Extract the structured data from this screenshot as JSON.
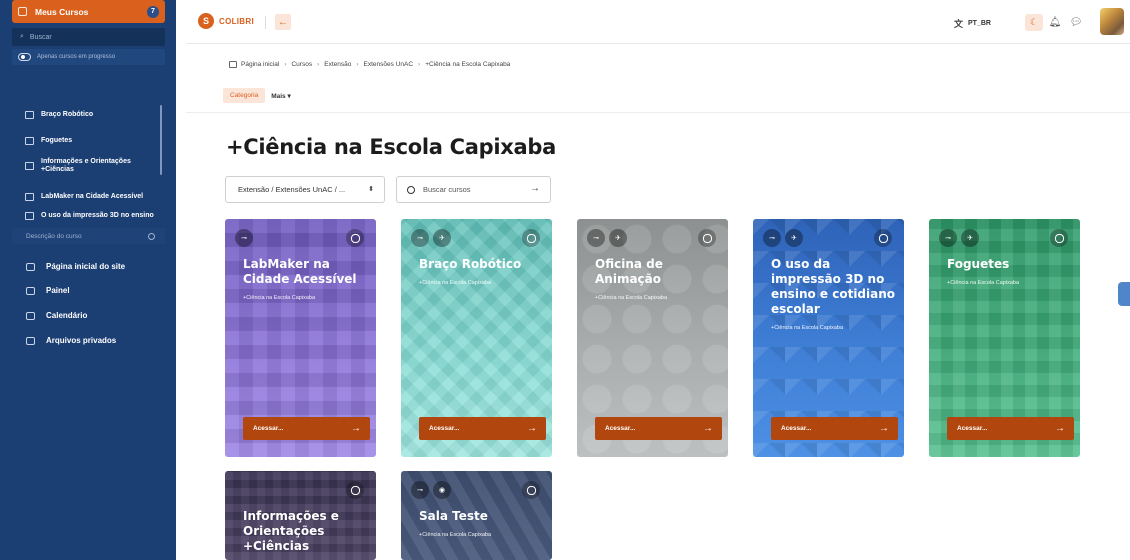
{
  "sidebar": {
    "title": "Meus Cursos",
    "badge": "7",
    "search_placeholder": "Buscar",
    "toggle_label": "Apenas cursos em progresso",
    "courses": [
      {
        "label": "Braço Robótico"
      },
      {
        "label": "Foguetes"
      },
      {
        "label": "Informações e Orientações +Ciências"
      },
      {
        "label": "LabMaker na Cidade Acessível"
      },
      {
        "label": "O uso da impressão 3D no ensino"
      }
    ],
    "description_label": "Descrição do curso",
    "nav": [
      {
        "label": "Página inicial do site"
      },
      {
        "label": "Painel"
      },
      {
        "label": "Calendário"
      },
      {
        "label": "Arquivos privados"
      }
    ]
  },
  "topbar": {
    "logo_letter": "S",
    "logo_text": "COLIBRI",
    "language": "PT_BR"
  },
  "breadcrumb": [
    "Página inicial",
    "Cursos",
    "Extensão",
    "Extensões UnAC",
    "+Ciência na Escola Capixaba"
  ],
  "category_button": "Categoria",
  "more_button": "Mais ▾",
  "page_title": "+Ciência na Escola Capixaba",
  "filter": {
    "select_value": "Extensão / Extensões UnAC / ...",
    "search_placeholder": "Buscar cursos"
  },
  "cards": [
    {
      "title": "LabMaker na Cidade Acessível",
      "subtitle": "+Ciência na Escola Capixaba",
      "button": "Acessar...",
      "color": "#8b73d6"
    },
    {
      "title": "Braço Robótico",
      "subtitle": "+Ciência na Escola Capixaba",
      "button": "Acessar...",
      "color": "#7fd8d0"
    },
    {
      "title": "Oficina de Animação",
      "subtitle": "+Ciência na Escola Capixaba",
      "button": "Acessar...",
      "color": "#a9acac"
    },
    {
      "title": "O uso da impressão 3D no ensino e cotidiano escolar",
      "subtitle": "+Ciência na Escola Capixaba",
      "button": "Acessar...",
      "color": "#3e7bd1"
    },
    {
      "title": "Foguetes",
      "subtitle": "+Ciência na Escola Capixaba",
      "button": "Acessar...",
      "color": "#3fae7b"
    },
    {
      "title": "Informações e Orientações +Ciências",
      "subtitle": "",
      "button": "Acessar...",
      "color": "#4e4466"
    },
    {
      "title": "Sala Teste",
      "subtitle": "+Ciência na Escola Capixaba",
      "button": "Acessar...",
      "color": "#4a5a7d"
    }
  ]
}
